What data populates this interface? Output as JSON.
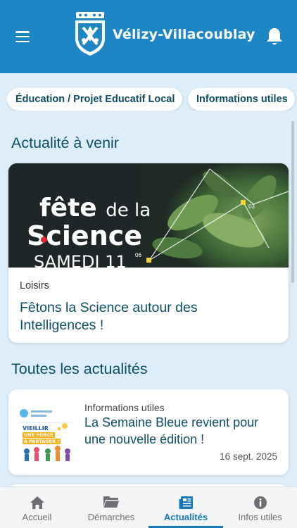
{
  "header": {
    "title": "Vélizy-Villacoublay",
    "bg_color": "#1d87c6",
    "menu_icon": "hamburger-menu-icon",
    "logo_icon": "city-crest-logo",
    "notification_icon": "bell-icon"
  },
  "chips": [
    {
      "label": "Éducation / Projet Educatif Local"
    },
    {
      "label": "Informations utiles"
    }
  ],
  "upcoming": {
    "title": "Actualité à venir",
    "card": {
      "image_text": {
        "line1a": "fête",
        "line1b": "de la",
        "line2": "Science",
        "line3": "SAMEDI 11"
      },
      "category": "Loisirs",
      "headline": "Fêtons la Science autour des Intelligences !"
    }
  },
  "all_news": {
    "title": "Toutes les actualités",
    "items": [
      {
        "thumb_text": {
          "top": "VIEILLIR",
          "middle": "UNE FORCE",
          "bottom": "À PARTAGER !"
        },
        "category": "Informations utiles",
        "headline": "La Semaine Bleue revient pour une nouvelle édition !",
        "date": "16 sept. 2025"
      }
    ]
  },
  "nav": {
    "items": [
      {
        "label": "Accueil",
        "icon": "home-icon"
      },
      {
        "label": "Démarches",
        "icon": "folder-icon"
      },
      {
        "label": "Actualités",
        "icon": "newspaper-icon",
        "active": true
      },
      {
        "label": "Infos utiles",
        "icon": "info-icon"
      }
    ],
    "active_color": "#1877b8"
  },
  "colors": {
    "accent": "#0b4e66",
    "page_bg": "#ddeefa"
  }
}
